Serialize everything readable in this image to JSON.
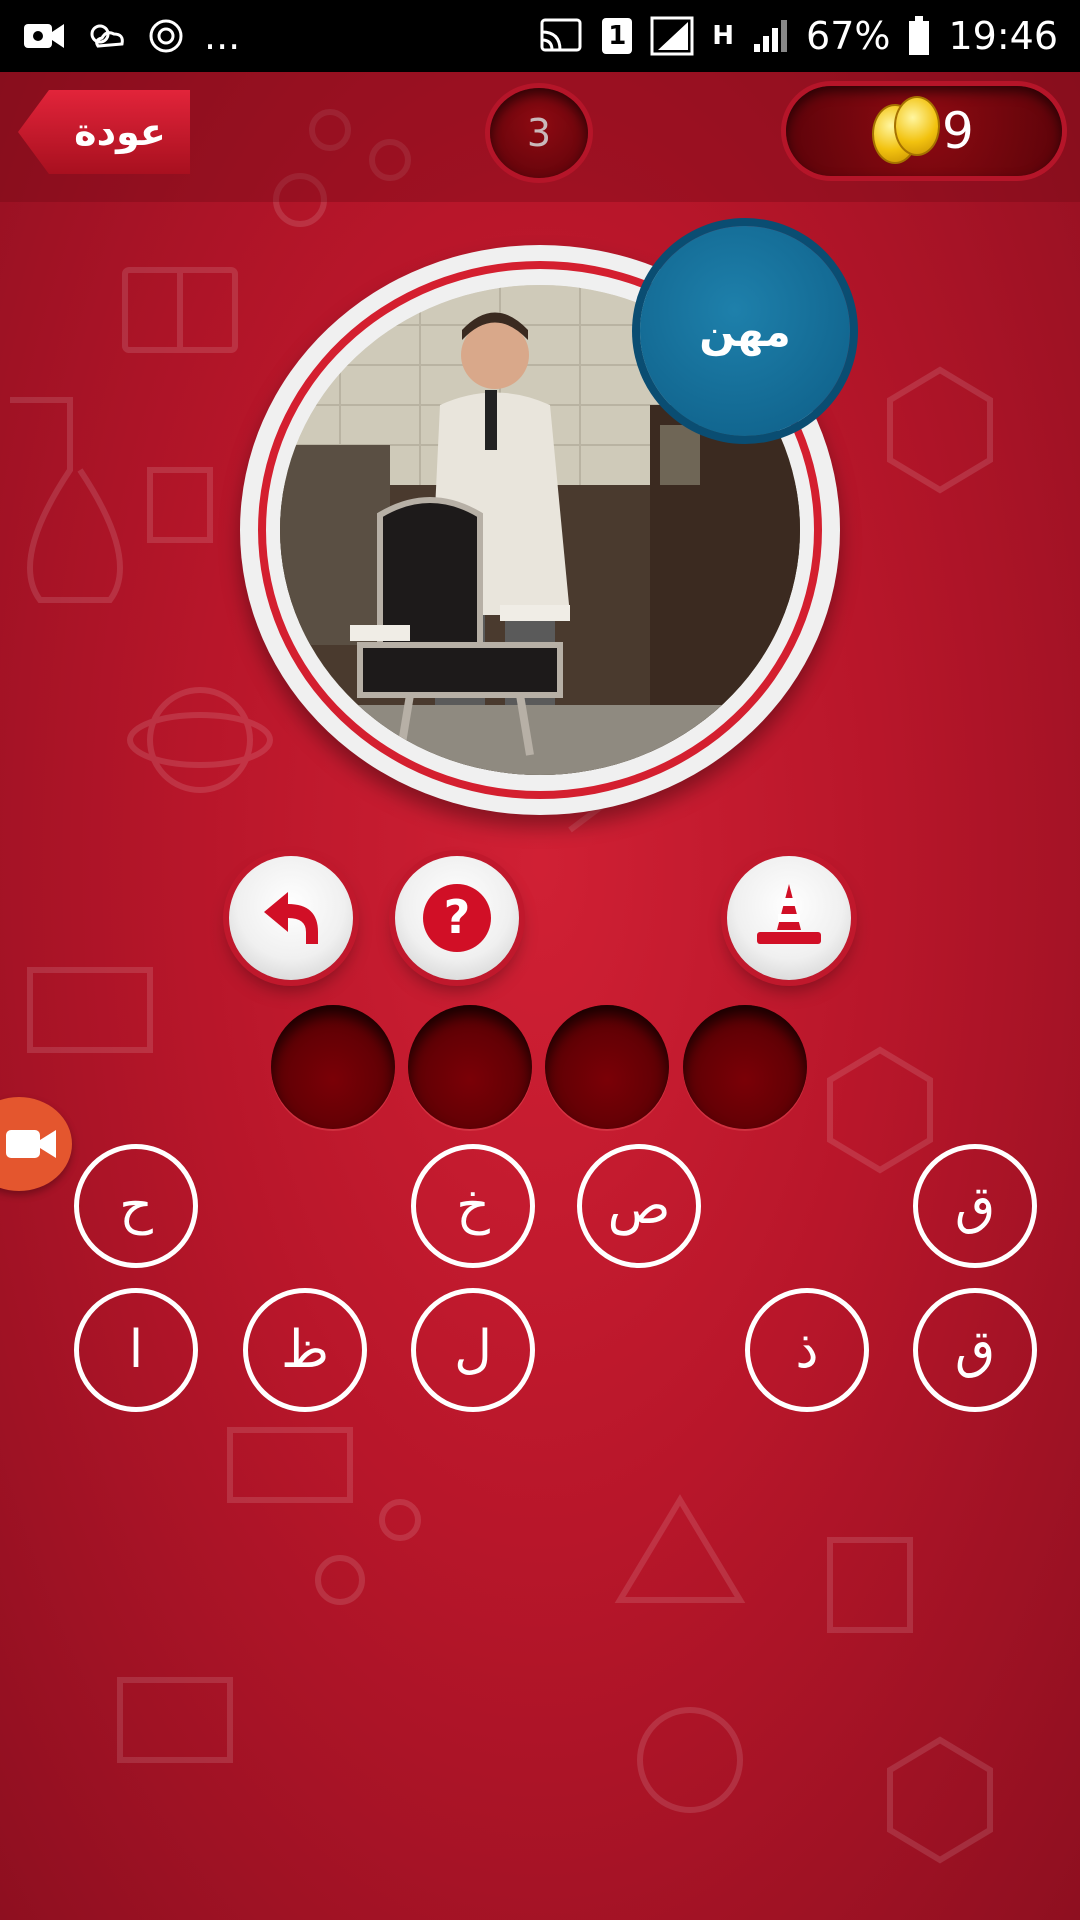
{
  "status_bar": {
    "dots": "...",
    "sim_badge": "1",
    "network_type": "H",
    "battery": "67%",
    "time": "19:46"
  },
  "header": {
    "back_label": "عودة",
    "level": "3",
    "coins": "9"
  },
  "category_label": "مهن",
  "letters": [
    "ح",
    "خ",
    "ص",
    "ق",
    "ا",
    "ظ",
    "ل",
    "ذ",
    "ق"
  ],
  "icons": {
    "undo": "undo-arrow-icon",
    "hint": "question-icon",
    "remove": "cone-icon"
  },
  "colors": {
    "background": "#b8162a",
    "category_badge": "#0d5d86",
    "slot": "#5a0004",
    "coin": "#f2c20f"
  }
}
